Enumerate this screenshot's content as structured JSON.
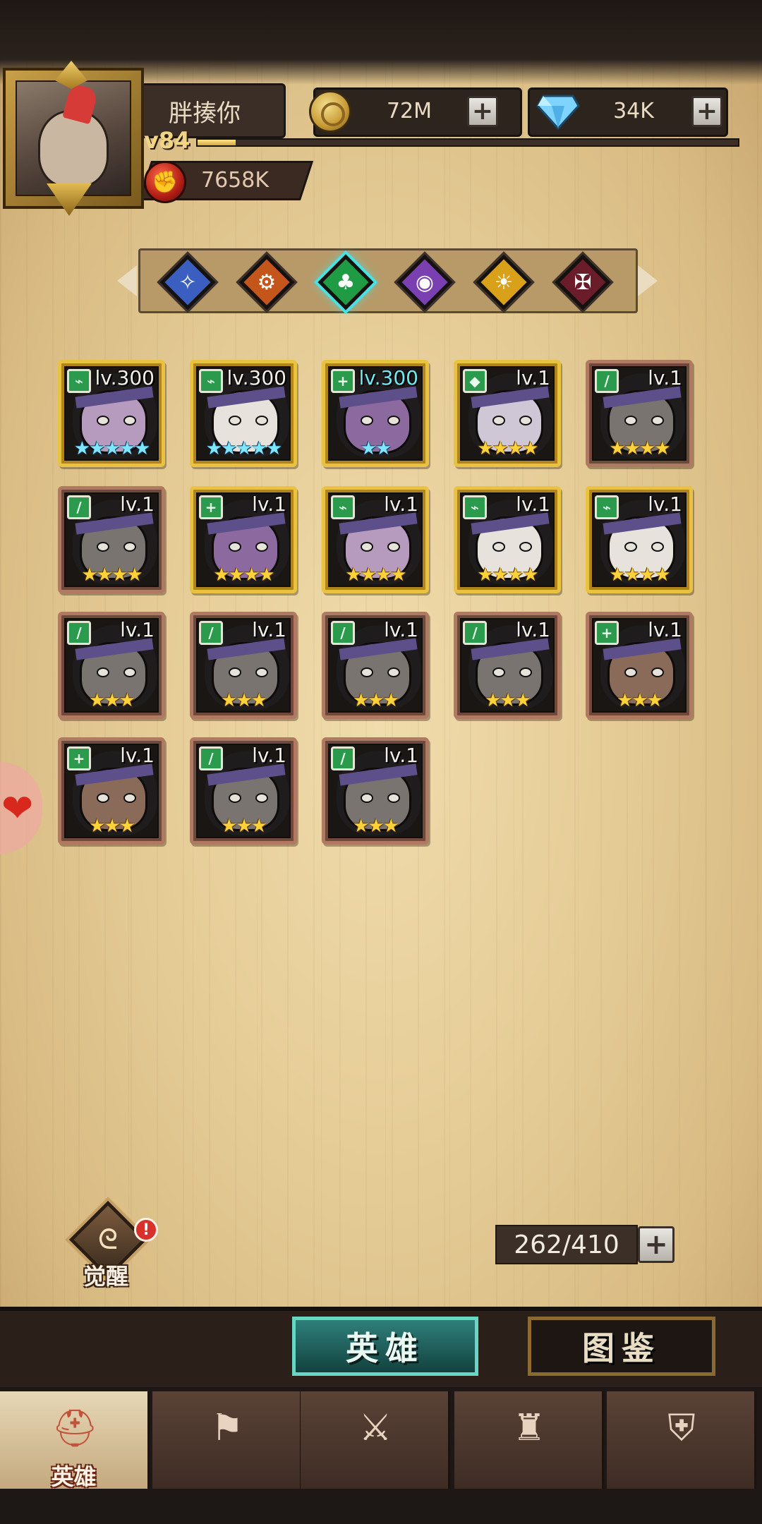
{
  "player": {
    "name": "胖揍你",
    "level": "lv84",
    "xp_fraction": 0.07,
    "power": "7658K"
  },
  "resources": {
    "gold": "72M",
    "gems": "34K"
  },
  "factions": [
    {
      "icon": "blue-faction-icon",
      "color": "#3a5fc0",
      "glyph": "✧"
    },
    {
      "icon": "orange-faction-icon",
      "color": "#c4561c",
      "glyph": "⚙"
    },
    {
      "icon": "green-faction-icon",
      "color": "#1f9b44",
      "glyph": "♣",
      "active": true
    },
    {
      "icon": "purple-faction-icon",
      "color": "#7a3fb0",
      "glyph": "◉"
    },
    {
      "icon": "gold-faction-icon",
      "color": "#d9a11a",
      "glyph": "☀"
    },
    {
      "icon": "crimson-faction-icon",
      "color": "#6a1c2a",
      "glyph": "✠"
    }
  ],
  "heroes": [
    {
      "level": "lv.300",
      "stars": "★★★★★",
      "star_color": "blue",
      "frame": "gold",
      "class_glyph": "⌁",
      "skin": "#b79bbf"
    },
    {
      "level": "lv.300",
      "stars": "★★★★★",
      "star_color": "blue",
      "frame": "gold",
      "class_glyph": "⌁",
      "skin": "#e8e2dc"
    },
    {
      "level": "lv.300",
      "stars": "★★",
      "star_color": "blue",
      "frame": "gold",
      "class_glyph": "+",
      "skin": "#8c6aa0",
      "level_color": "cyan"
    },
    {
      "level": "lv.1",
      "stars": "★★★★",
      "star_color": "gold",
      "frame": "gold",
      "class_glyph": "◆",
      "skin": "#cfc6d6"
    },
    {
      "level": "lv.1",
      "stars": "★★★★",
      "star_color": "gold",
      "frame": "bronze",
      "class_glyph": "/",
      "skin": "#7a7470"
    },
    {
      "level": "lv.1",
      "stars": "★★★★",
      "star_color": "gold",
      "frame": "bronze",
      "class_glyph": "/",
      "skin": "#7a7470"
    },
    {
      "level": "lv.1",
      "stars": "★★★★",
      "star_color": "gold",
      "frame": "gold",
      "class_glyph": "+",
      "skin": "#8c6aa0"
    },
    {
      "level": "lv.1",
      "stars": "★★★★",
      "star_color": "gold",
      "frame": "gold",
      "class_glyph": "⌁",
      "skin": "#b79bbf"
    },
    {
      "level": "lv.1",
      "stars": "★★★★",
      "star_color": "gold",
      "frame": "gold",
      "class_glyph": "⌁",
      "skin": "#e8e2dc"
    },
    {
      "level": "lv.1",
      "stars": "★★★★",
      "star_color": "gold",
      "frame": "gold",
      "class_glyph": "⌁",
      "skin": "#e8e2dc"
    },
    {
      "level": "lv.1",
      "stars": "★★★",
      "star_color": "gold",
      "frame": "bronze",
      "class_glyph": "/",
      "skin": "#7a7470"
    },
    {
      "level": "lv.1",
      "stars": "★★★",
      "star_color": "gold",
      "frame": "bronze",
      "class_glyph": "/",
      "skin": "#7a7470"
    },
    {
      "level": "lv.1",
      "stars": "★★★",
      "star_color": "gold",
      "frame": "bronze",
      "class_glyph": "/",
      "skin": "#7a7470"
    },
    {
      "level": "lv.1",
      "stars": "★★★",
      "star_color": "gold",
      "frame": "bronze",
      "class_glyph": "/",
      "skin": "#7a7470"
    },
    {
      "level": "lv.1",
      "stars": "★★★",
      "star_color": "gold",
      "frame": "bronze",
      "class_glyph": "+",
      "skin": "#8a6a58"
    },
    {
      "level": "lv.1",
      "stars": "★★★",
      "star_color": "gold",
      "frame": "bronze",
      "class_glyph": "+",
      "skin": "#8a6a58"
    },
    {
      "level": "lv.1",
      "stars": "★★★",
      "star_color": "gold",
      "frame": "bronze",
      "class_glyph": "/",
      "skin": "#7a7470"
    },
    {
      "level": "lv.1",
      "stars": "★★★",
      "star_color": "gold",
      "frame": "bronze",
      "class_glyph": "/",
      "skin": "#7a7470"
    }
  ],
  "awaken": {
    "label": "觉醒",
    "badge": "!"
  },
  "capacity": "262/410",
  "tabs": {
    "heroes": "英雄",
    "codex": "图鉴"
  },
  "nav": [
    {
      "icon": "helmet-icon",
      "label": "英雄",
      "glyph": "⛑",
      "active": true
    },
    {
      "icon": "flag-icon",
      "label": "",
      "glyph": "⚑"
    },
    {
      "icon": "crossed-swords-icon",
      "label": "",
      "glyph": "⚔"
    },
    {
      "icon": "castle-icon",
      "label": "",
      "glyph": "♜"
    },
    {
      "icon": "guild-icon",
      "label": "",
      "glyph": "⛨"
    }
  ]
}
